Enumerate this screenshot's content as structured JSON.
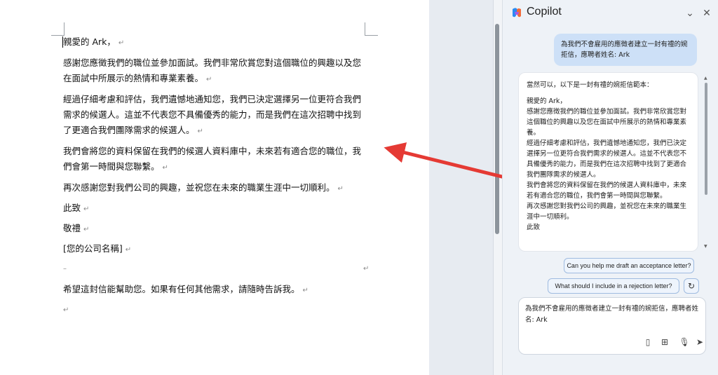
{
  "document": {
    "paragraphs": [
      "親愛的 Ark，",
      "感謝您應徵我們的職位並參加面試。我們非常欣賞您對這個職位的興趣以及您在面試中所展示的熱情和專業素養。",
      "經過仔細考慮和評估，我們遺憾地通知您，我們已決定選擇另一位更符合我們需求的候選人。這並不代表您不具備優秀的能力，而是我們在這次招聘中找到了更適合我們團隊需求的候選人。",
      "我們會將您的資料保留在我們的候選人資料庫中，未來若有適合您的職位，我們會第一時間與您聯繫。",
      "再次感謝您對我們公司的興趣，並祝您在未來的職業生涯中一切順利。",
      "此致",
      "敬禮",
      "[您的公司名稱]",
      "希望這封信能幫助您。如果有任何其他需求，請隨時告訴我。"
    ],
    "para_mark": "↵",
    "separator": "–"
  },
  "copilot": {
    "title": "Copilot",
    "user_message": "為我們不會雇用的應徵者建立一封有禮的婉拒信，應聘者姓名: Ark",
    "reply": {
      "intro": "當然可以，以下是一封有禮的婉拒信範本：",
      "lines": [
        "親愛的 Ark，",
        "感謝您應徵我們的職位並參加面試。我們非常欣賞您對這個職位的興趣以及您在面試中所展示的熱情和專業素養。",
        "經過仔細考慮和評估，我們遺憾地通知您，我們已決定選擇另一位更符合我們需求的候選人。這並不代表您不具備優秀的能力，而是我們在這次招聘中找到了更適合我們團隊需求的候選人。",
        "我們會將您的資料保留在我們的候選人資料庫中，未來若有適合您的職位，我們會第一時間與您聯繫。",
        "再次感謝您對我們公司的興趣，並祝您在未來的職業生涯中一切順利。",
        "此致"
      ]
    },
    "suggestions": [
      "Can you help me draft an acceptance letter?",
      "What should I include in a rejection letter?"
    ],
    "input_value": "為我們不會雇用的應徵者建立一封有禮的婉拒信，應聘者姓名: Ark",
    "icons": [
      "chevron-down-icon",
      "close-icon",
      "refresh-icon",
      "notebook-icon",
      "apps-icon",
      "mic-icon",
      "send-icon"
    ]
  },
  "colors": {
    "arrow": "#e53a34",
    "user_bubble": "#cde0f7",
    "panel_bg": "#eef2f7"
  }
}
